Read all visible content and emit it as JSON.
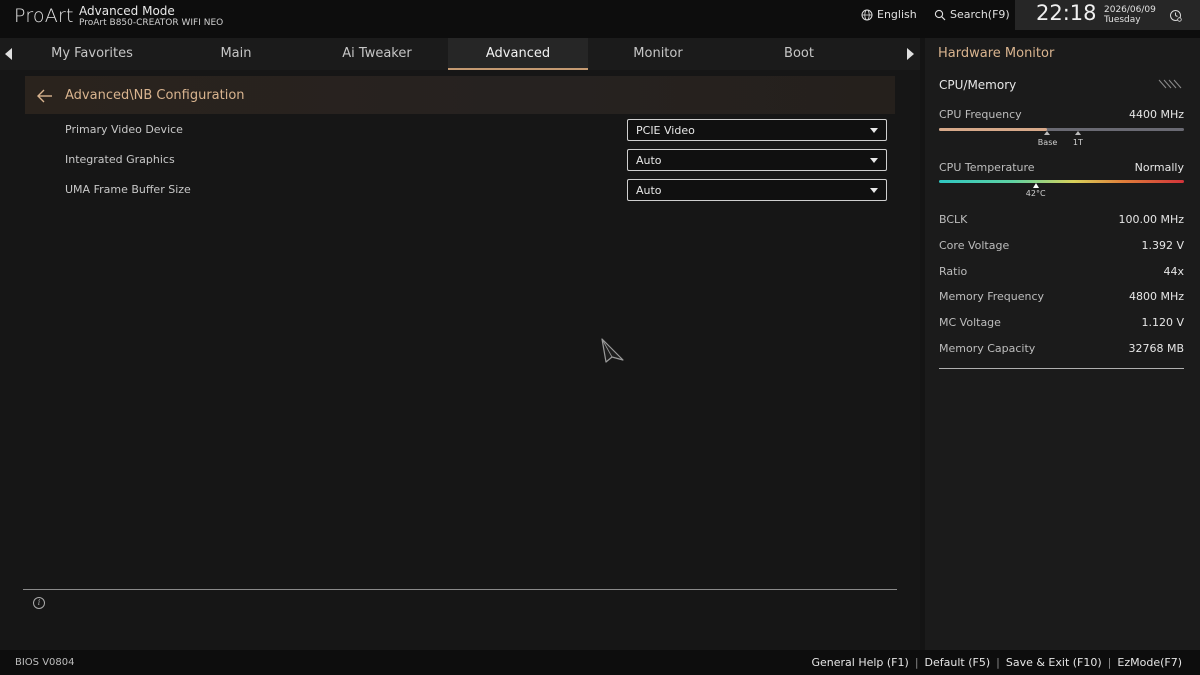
{
  "header": {
    "logo": "ProArt",
    "mode": "Advanced Mode",
    "model": "ProArt B850-CREATOR WIFI NEO",
    "language": "English",
    "search": "Search(F9)",
    "time": "22:18",
    "date": "2026/06/09",
    "weekday": "Tuesday"
  },
  "tabs": [
    {
      "label": "My Favorites",
      "active": false
    },
    {
      "label": "Main",
      "active": false
    },
    {
      "label": "Ai Tweaker",
      "active": false
    },
    {
      "label": "Advanced",
      "active": true
    },
    {
      "label": "Monitor",
      "active": false
    },
    {
      "label": "Boot",
      "active": false
    }
  ],
  "breadcrumb": "Advanced\\NB Configuration",
  "settings": [
    {
      "label": "Primary Video Device",
      "value": "PCIE Video"
    },
    {
      "label": "Integrated Graphics",
      "value": "Auto"
    },
    {
      "label": "UMA Frame Buffer Size",
      "value": "Auto"
    }
  ],
  "hardware_monitor": {
    "title": "Hardware Monitor",
    "section": "CPU/Memory",
    "cpu_frequency": {
      "label": "CPU Frequency",
      "value": "4400 MHz",
      "fill_fraction": 0.44,
      "base_label": "Base",
      "base_fraction": 0.44,
      "one_t_label": "1T",
      "one_t_fraction": 0.567
    },
    "cpu_temperature": {
      "label": "CPU Temperature",
      "value": "Normally",
      "reading": "42°C",
      "fraction": 0.395
    },
    "items": [
      {
        "label": "BCLK",
        "value": "100.00 MHz"
      },
      {
        "label": "Core Voltage",
        "value": "1.392 V"
      },
      {
        "label": "Ratio",
        "value": "44x"
      },
      {
        "label": "Memory Frequency",
        "value": "4800 MHz"
      },
      {
        "label": "MC Voltage",
        "value": "1.120 V"
      },
      {
        "label": "Memory Capacity",
        "value": "32768 MB"
      }
    ]
  },
  "footer": {
    "bios_version": "BIOS V0804",
    "general_help": "General Help (F1)",
    "default": "Default (F5)",
    "save_exit": "Save & Exit (F10)",
    "ezmode": "EzMode(F7)"
  },
  "colors": {
    "accent": "#d9b48f",
    "active_tab_underline": "#c49a72"
  }
}
